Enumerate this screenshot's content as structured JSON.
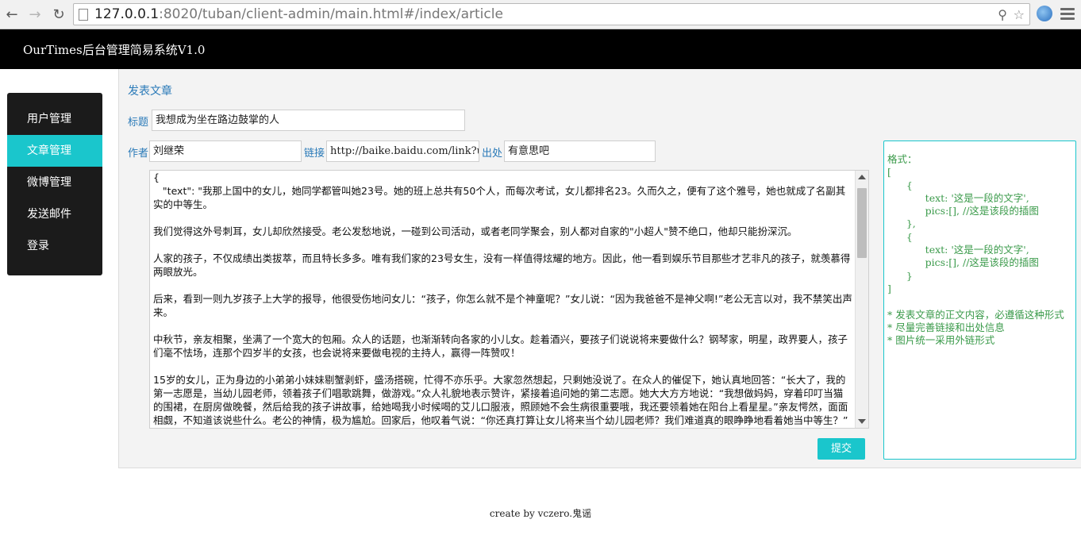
{
  "browser": {
    "url_host": "127.0.0.1",
    "url_rest": ":8020/tuban/client-admin/main.html#/index/article"
  },
  "header": {
    "title": "OurTimes后台管理简易系统V1.0"
  },
  "sidebar": {
    "items": [
      {
        "label": "用户管理"
      },
      {
        "label": "文章管理"
      },
      {
        "label": "微博管理"
      },
      {
        "label": "发送邮件"
      },
      {
        "label": "登录"
      }
    ]
  },
  "form": {
    "heading": "发表文章",
    "title_label": "标题",
    "title_value": "我想成为坐在路边鼓掌的人",
    "author_label": "作者",
    "author_value": "刘继荣",
    "link_label": "链接",
    "link_value": "http://baike.baidu.com/link?url",
    "source_label": "出处",
    "source_value": "有意思吧",
    "content_value": "{\n   \"text\": \"我那上国中的女儿，她同学都管叫她23号。她的班上总共有50个人，而每次考试，女儿都排名23。久而久之，便有了这个雅号，她也就成了名副其实的中等生。\n\n我们觉得这外号刺耳，女儿却欣然接受。老公发愁地说，一碰到公司活动，或者老同学聚会，别人都对自家的\"小超人\"赞不绝口，他却只能扮深沉。\n\n人家的孩子，不仅成绩出类拔萃，而且特长多多。唯有我们家的23号女生，没有一样值得炫耀的地方。因此，他一看到娱乐节目那些才艺非凡的孩子，就羡慕得两眼放光。\n\n后来，看到一则九岁孩子上大学的报导，他很受伤地问女儿：“孩子，你怎么就不是个神童呢？”女儿说：“因为我爸爸不是神父啊!”老公无言以对，我不禁笑出声来。\n\n中秋节，亲友相聚，坐满了一个宽大的包厢。众人的话题，也渐渐转向各家的小儿女。趁着酒兴，要孩子们说说将来要做什么？钢琴家，明星，政界要人，孩子们毫不怯场，连那个四岁半的女孩，也会说将来要做电视的主持人，赢得一阵赞叹！\n\n15岁的女儿，正为身边的小弟弟小妹妹剔蟹剥虾，盛汤搭碗，忙得不亦乐乎。大家忽然想起，只剩她没说了。在众人的催促下，她认真地回答：“长大了，我的第一志愿是，当幼儿园老师，领着孩子们唱歌跳舞，做游戏。”众人礼貌地表示赞许，紧接着追问她的第二志愿。她大大方方地说：“我想做妈妈，穿着印叮当猫的围裙，在厨房做晚餐，然后给我的孩子讲故事，给她喝我小时候喝的艾儿口服液，照顾她不会生病很重要哦，我还要领着她在阳台上看星星。”亲友愕然，面面相觑，不知道该说些什么。老公的神情，极为尴尬。回家后，他叹着气说：“你还真打算让女儿将来当个幼儿园老师？我们难道真的眼睁睁地看着她当中等生？”",
    "submit_label": "提交"
  },
  "hint": {
    "text": "格式：\n[\n      {\n            text: '这是一段的文字',\n            pics:[], //这是该段的插图\n      },\n      {\n            text: '这是一段的文字',\n            pics:[], //这是该段的插图\n      }\n]\n\n* 发表文章的正文内容，必遵循这种形式\n* 尽量完善链接和出处信息\n* 图片统一采用外链形式"
  },
  "footer": {
    "text": "create by vczero.鬼谣"
  },
  "colors": {
    "accent": "#1ac6cc",
    "header_bg": "#000000",
    "sidebar_bg": "#1b1b1b",
    "label": "#2a7ab8",
    "hint": "#3a9a4a"
  },
  "icons": [
    "back-icon",
    "forward-icon",
    "reload-icon",
    "page-icon",
    "key-icon",
    "star-icon",
    "globe-icon",
    "menu-icon"
  ]
}
